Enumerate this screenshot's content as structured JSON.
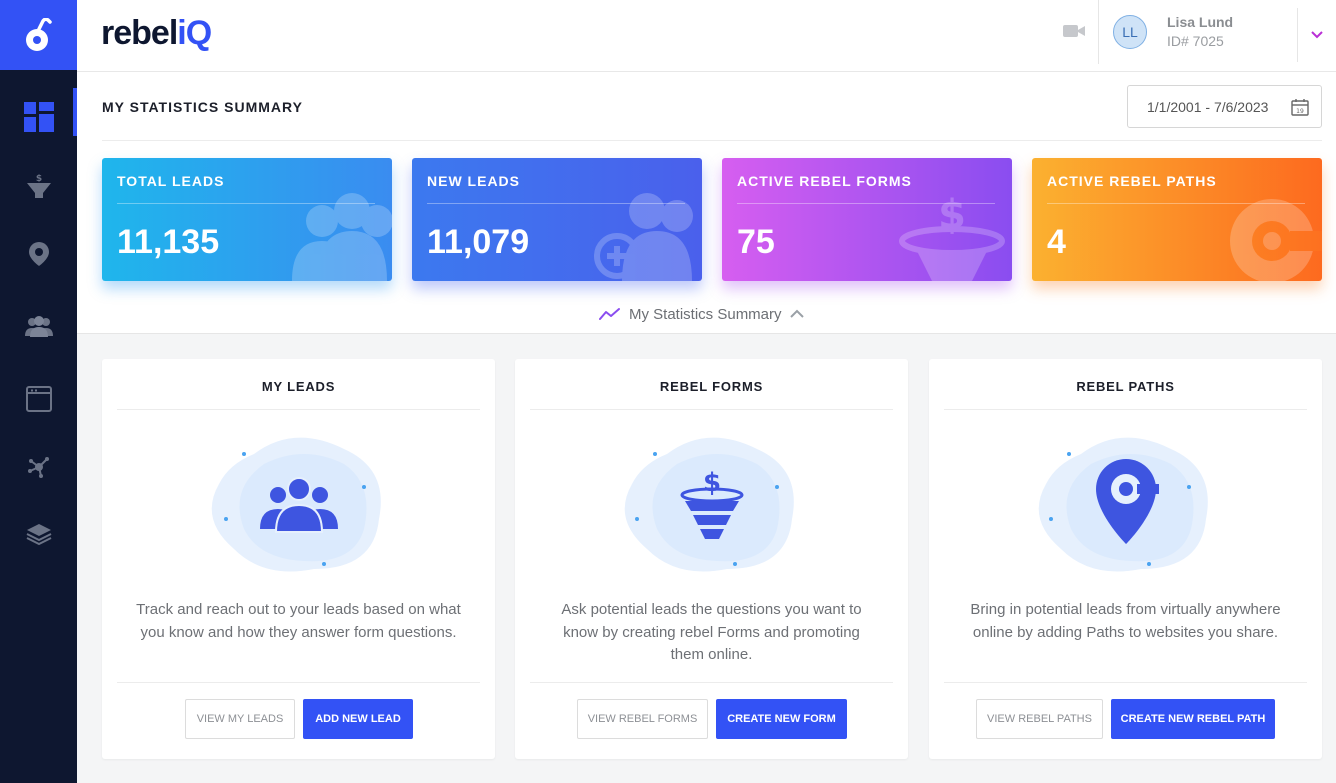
{
  "brand": {
    "word": "rebel",
    "accent": "iQ",
    "color": "#0e1730",
    "accent_color": "#3352f5"
  },
  "sidebar": {
    "items": [
      {
        "icon": "dashboard-icon",
        "active": true
      },
      {
        "icon": "funnel-dollar-icon",
        "active": false
      },
      {
        "icon": "location-pin-icon",
        "active": false
      },
      {
        "icon": "users-group-icon",
        "active": false
      },
      {
        "icon": "browser-window-icon",
        "active": false
      },
      {
        "icon": "network-nodes-icon",
        "active": false
      },
      {
        "icon": "layers-stack-icon",
        "active": false
      }
    ]
  },
  "header": {
    "user": {
      "initials": "LL",
      "name": "Lisa Lund",
      "id_label": "ID# 7025"
    }
  },
  "summary": {
    "title": "MY STATISTICS SUMMARY",
    "date_range": "1/1/2001 - 7/6/2023",
    "calendar_day": "19",
    "toggle_label": "My Statistics Summary",
    "stats": [
      {
        "label": "TOTAL LEADS",
        "value": "11,135",
        "colors": [
          "#1fb6ec",
          "#3a8cf0"
        ]
      },
      {
        "label": "NEW LEADS",
        "value": "11,079",
        "colors": [
          "#3c79ef",
          "#4a60ec"
        ]
      },
      {
        "label": "ACTIVE REBEL FORMS",
        "value": "75",
        "colors": [
          "#d65ef0",
          "#8a4df0"
        ]
      },
      {
        "label": "ACTIVE REBEL PATHS",
        "value": "4",
        "colors": [
          "#fbb130",
          "#fd6a1f"
        ]
      }
    ]
  },
  "cards": [
    {
      "title": "MY LEADS",
      "icon": "leads-group-icon",
      "desc": "Track and reach out to your leads based on what you know and how they answer form questions.",
      "secondary": "VIEW MY LEADS",
      "primary": "ADD NEW LEAD"
    },
    {
      "title": "REBEL FORMS",
      "icon": "funnel-dollar-icon",
      "desc": "Ask potential leads the questions you want to know by creating rebel Forms and promoting them online.",
      "secondary": "VIEW REBEL FORMS",
      "primary": "CREATE NEW FORM"
    },
    {
      "title": "REBEL PATHS",
      "icon": "path-pin-icon",
      "desc": "Bring in potential leads from virtually anywhere online by adding Paths to websites you share.",
      "secondary": "VIEW REBEL PATHS",
      "primary": "CREATE NEW REBEL PATH"
    }
  ],
  "colors": {
    "primary": "#3352f5",
    "sidebar_bg": "#0e1730",
    "chevron": "#b92fd6"
  }
}
